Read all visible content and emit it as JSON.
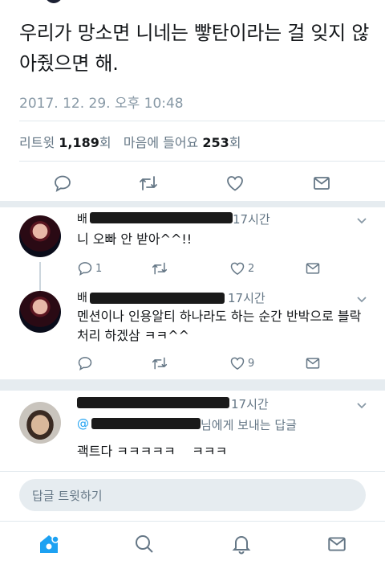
{
  "tweet": {
    "text": "우리가 망소면 니네는 빻탄이라는 걸 잊지 않아줬으면 해.",
    "timestamp": "2017. 12. 29. 오후 10:48",
    "retweet_label": "리트윗",
    "retweet_count": "1,189",
    "like_label": "마음에 들어요",
    "like_count": "253",
    "count_suffix": "회"
  },
  "replies": [
    {
      "name_visible": "배",
      "time": "17시간",
      "text": "니 오빠 안 받아^^!!",
      "reply_count": "1",
      "like_count": "2"
    },
    {
      "name_visible": "배",
      "time": "17시간",
      "text": "멘션이나 인용알티 하나라도 하는 순간 반박으로 블락 처리 하겠삼 ㅋㅋ^^",
      "like_count": "9"
    },
    {
      "time": "17시간",
      "reply_to_suffix": "님에게 보내는 답글",
      "text": "괙트다 ㅋㅋㅋㅋㅋ    ㅋㅋㅋ"
    }
  ],
  "compose": {
    "placeholder": "답글 트윗하기"
  },
  "icons": {
    "reply": "reply-icon",
    "retweet": "retweet-icon",
    "like": "heart-icon",
    "message": "envelope-icon",
    "home": "home-icon",
    "search": "search-icon",
    "notifications": "bell-icon"
  },
  "colors": {
    "accent": "#1da1f2",
    "icon": "#657786",
    "muted": "#8899a6",
    "divider": "#e1e8ed"
  }
}
